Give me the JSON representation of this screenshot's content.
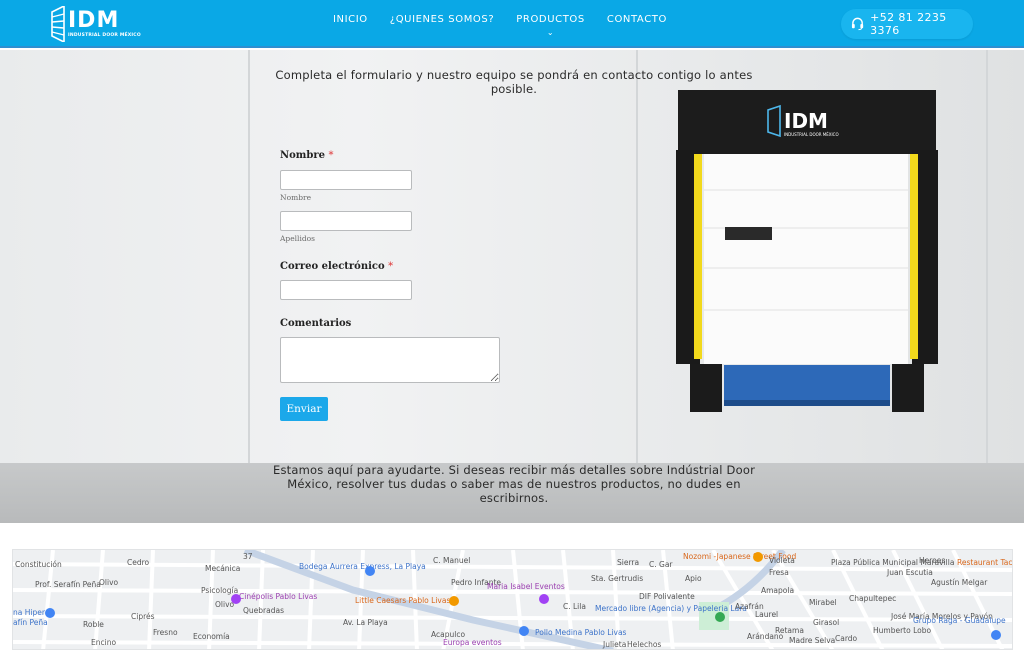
{
  "header": {
    "logo": {
      "text": "IDM",
      "subtext": "INDUSTRIAL DOOR MÉXICO"
    },
    "nav": [
      {
        "label": "INICIO"
      },
      {
        "label": "¿QUIENES SOMOS?"
      },
      {
        "label": "PRODUCTOS",
        "has_dropdown": true
      },
      {
        "label": "CONTACTO"
      }
    ],
    "phone": "+52 81 2235 3376",
    "colors": {
      "bar": "#0aa8e6",
      "button": "#19b5ef"
    }
  },
  "hero": {
    "intro": "Completa el formulario y nuestro equipo se pondrá en contacto contigo lo antes posible.",
    "help": "Estamos aquí para ayudarte. Si deseas recibir más detalles sobre Indústrial Door México, resolver tus dudas o saber mas de nuestros productos, no dudes en escribirnos."
  },
  "form": {
    "name_label": "Nombre",
    "required_mark": "*",
    "first_sublabel": "Nombre",
    "last_sublabel": "Apellidos",
    "email_label": "Correo electrónico",
    "comments_label": "Comentarios",
    "submit_label": "Enviar",
    "first_value": "",
    "last_value": "",
    "email_value": "",
    "comments_value": ""
  },
  "door_image": {
    "brand": "IDM",
    "subtext": "INDUSTRIAL DOOR MÉXICO"
  },
  "map": {
    "labels": [
      {
        "text": "Cedro"
      },
      {
        "text": "Mecánica"
      },
      {
        "text": "Olivo"
      },
      {
        "text": "Psicología"
      },
      {
        "text": "Olivo"
      },
      {
        "text": "Quebradas"
      },
      {
        "text": "Ciprés"
      },
      {
        "text": "Roble"
      },
      {
        "text": "Fresno"
      },
      {
        "text": "Economía"
      },
      {
        "text": "Encino"
      },
      {
        "text": "Prof. Serafín Peña"
      },
      {
        "text": "Constitución"
      },
      {
        "text": "na Hiper"
      },
      {
        "text": "afín Peña"
      },
      {
        "text": "Bodega Aurrera Express, La Playa"
      },
      {
        "text": "Cinépolis Pablo Livas"
      },
      {
        "text": "Little Caesars Pablo Livas"
      },
      {
        "text": "Av. La Playa"
      },
      {
        "text": "C. Manuel"
      },
      {
        "text": "Pedro Infante"
      },
      {
        "text": "Acapulco"
      },
      {
        "text": "Maria Isabel Eventos"
      },
      {
        "text": "Europa eventos"
      },
      {
        "text": "Pollo Medina Pablo Livas"
      },
      {
        "text": "C. Lila"
      },
      {
        "text": "Sta. Gertrudis"
      },
      {
        "text": "Sierra"
      },
      {
        "text": "C. Gar"
      },
      {
        "text": "Mercado libre (Agencia) y Papeleria Lara"
      },
      {
        "text": "DIF Polivalente"
      },
      {
        "text": "Nozomi -Japanese Street Food"
      },
      {
        "text": "Apio"
      },
      {
        "text": "Violeta"
      },
      {
        "text": "Fresa"
      },
      {
        "text": "Azafrán"
      },
      {
        "text": "Laurel"
      },
      {
        "text": "Amapola"
      },
      {
        "text": "Retama"
      },
      {
        "text": "Arándano"
      },
      {
        "text": "Madre Selva"
      },
      {
        "text": "Mirabel"
      },
      {
        "text": "Girasol"
      },
      {
        "text": "Cardo"
      },
      {
        "text": "Plaza Pública Municipal Maravilla"
      },
      {
        "text": "Chapultepec"
      },
      {
        "text": "Juan Escutia"
      },
      {
        "text": "Heroes"
      },
      {
        "text": "Agustín Melgar"
      },
      {
        "text": "Humberto Lobo"
      },
      {
        "text": "José María Morelos y Pavón"
      },
      {
        "text": "Grupo Raga - Guadalupe"
      },
      {
        "text": "Restaurant Tac"
      },
      {
        "text": "37"
      },
      {
        "text": "Julieta"
      },
      {
        "text": "Helechos"
      }
    ]
  }
}
